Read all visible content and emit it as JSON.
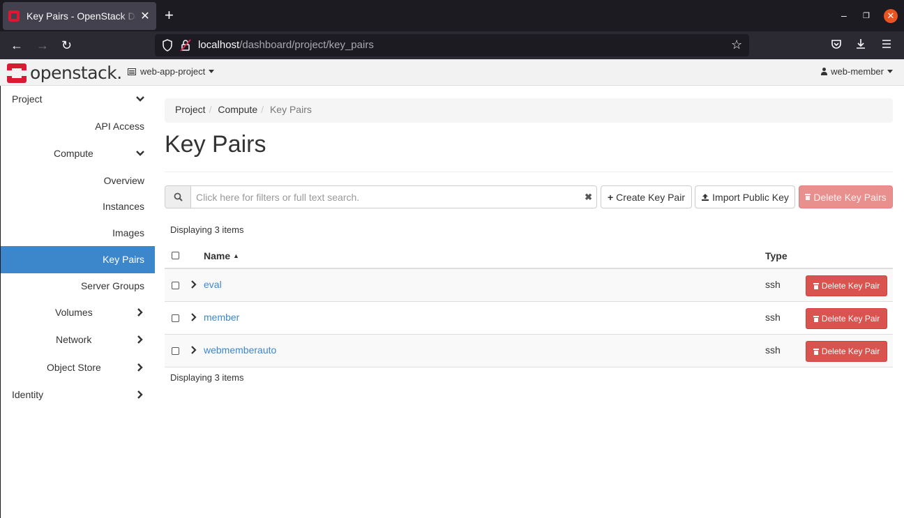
{
  "browser": {
    "tab_title": "Key Pairs - OpenStack Dashboard",
    "url_host": "localhost",
    "url_path": "/dashboard/project/key_pairs"
  },
  "header": {
    "logo_text": "openstack.",
    "project": "web-app-project",
    "user": "web-member",
    "brand_color": "#da1a32"
  },
  "sidebar": {
    "items": [
      {
        "label": "Project"
      },
      {
        "label": "API Access"
      },
      {
        "label": "Compute"
      },
      {
        "label": "Overview"
      },
      {
        "label": "Instances"
      },
      {
        "label": "Images"
      },
      {
        "label": "Key Pairs"
      },
      {
        "label": "Server Groups"
      },
      {
        "label": "Volumes"
      },
      {
        "label": "Network"
      },
      {
        "label": "Object Store"
      },
      {
        "label": "Identity"
      }
    ],
    "active_color": "#3c87cc"
  },
  "breadcrumb": {
    "items": [
      "Project",
      "Compute",
      "Key Pairs"
    ]
  },
  "main": {
    "title": "Key Pairs",
    "search_placeholder": "Click here for filters or full text search.",
    "create_label": "Create Key Pair",
    "import_label": "Import Public Key",
    "delete_all_label": "Delete Key Pairs",
    "count_text": "Displaying 3 items"
  },
  "table": {
    "columns": [
      "Name",
      "Type"
    ],
    "rows": [
      {
        "name": "eval",
        "type": "ssh",
        "action": "Delete Key Pair"
      },
      {
        "name": "member",
        "type": "ssh",
        "action": "Delete Key Pair"
      },
      {
        "name": "webmemberauto",
        "type": "ssh",
        "action": "Delete Key Pair"
      }
    ]
  }
}
